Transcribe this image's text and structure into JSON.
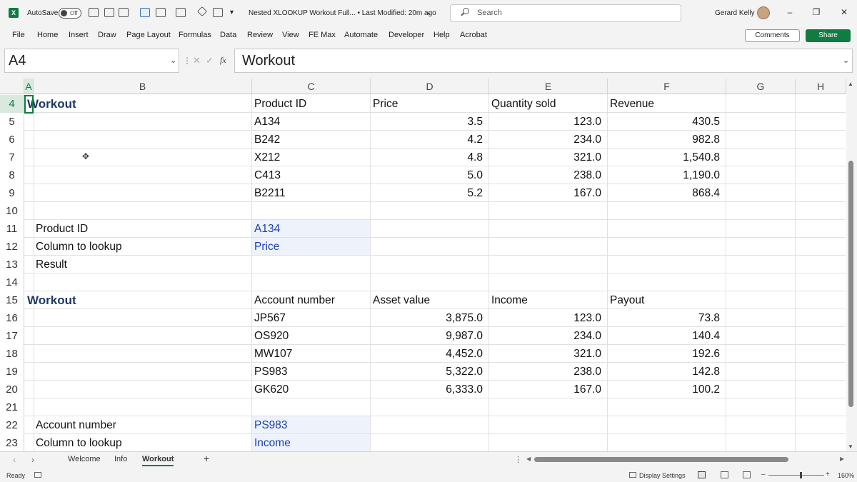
{
  "titlebar": {
    "autosave_label": "AutoSave",
    "autosave_state": "Off",
    "document_title": "Nested XLOOKUP Workout Full... • Last Modified: 20m ago",
    "search_placeholder": "Search",
    "user_name": "Gerard Kelly"
  },
  "menu": {
    "items": [
      "File",
      "Home",
      "Insert",
      "Draw",
      "Page Layout",
      "Formulas",
      "Data",
      "Review",
      "View",
      "FE Max",
      "Automate",
      "Developer",
      "Help",
      "Acrobat"
    ],
    "comments_label": "Comments",
    "share_label": "Share"
  },
  "formula_bar": {
    "name_box": "A4",
    "fx_symbol": "fx",
    "content": "Workout"
  },
  "columns": [
    "A",
    "B",
    "C",
    "D",
    "E",
    "F",
    "G",
    "H"
  ],
  "rows": {
    "r4": {
      "num": "4",
      "a": "Workout",
      "c": "Product ID",
      "d": "Price",
      "e": "Quantity sold",
      "f": "Revenue"
    },
    "r5": {
      "num": "5",
      "c": "A134",
      "d": "3.5",
      "e": "123.0",
      "f": "430.5"
    },
    "r6": {
      "num": "6",
      "c": "B242",
      "d": "4.2",
      "e": "234.0",
      "f": "982.8"
    },
    "r7": {
      "num": "7",
      "c": "X212",
      "d": "4.8",
      "e": "321.0",
      "f": "1,540.8"
    },
    "r8": {
      "num": "8",
      "c": "C413",
      "d": "5.0",
      "e": "238.0",
      "f": "1,190.0"
    },
    "r9": {
      "num": "9",
      "c": "B2211",
      "d": "5.2",
      "e": "167.0",
      "f": "868.4"
    },
    "r10": {
      "num": "10"
    },
    "r11": {
      "num": "11",
      "b": "Product ID",
      "c": "A134"
    },
    "r12": {
      "num": "12",
      "b": "Column to lookup",
      "c": "Price"
    },
    "r13": {
      "num": "13",
      "b": "Result"
    },
    "r14": {
      "num": "14"
    },
    "r15": {
      "num": "15",
      "a": "Workout",
      "c": "Account number",
      "d": "Asset value",
      "e": "Income",
      "f": "Payout"
    },
    "r16": {
      "num": "16",
      "c": "JP567",
      "d": "3,875.0",
      "e": "123.0",
      "f": "73.8"
    },
    "r17": {
      "num": "17",
      "c": "OS920",
      "d": "9,987.0",
      "e": "234.0",
      "f": "140.4"
    },
    "r18": {
      "num": "18",
      "c": "MW107",
      "d": "4,452.0",
      "e": "321.0",
      "f": "192.6"
    },
    "r19": {
      "num": "19",
      "c": "PS983",
      "d": "5,322.0",
      "e": "238.0",
      "f": "142.8"
    },
    "r20": {
      "num": "20",
      "c": "GK620",
      "d": "6,333.0",
      "e": "167.0",
      "f": "100.2"
    },
    "r21": {
      "num": "21"
    },
    "r22": {
      "num": "22",
      "b": "Account number",
      "c": "PS983"
    },
    "r23": {
      "num": "23",
      "b": "Column to lookup",
      "c": "Income"
    }
  },
  "sheet_tabs": {
    "tabs": [
      "Welcome",
      "Info",
      "Workout"
    ],
    "active": "Workout",
    "add_label": "+"
  },
  "status_bar": {
    "ready": "Ready",
    "display_settings": "Display Settings",
    "zoom": "160%"
  },
  "colors": {
    "accent": "#107c41",
    "header_text": "#1f3864",
    "input_blue": "#1a3fb0"
  }
}
